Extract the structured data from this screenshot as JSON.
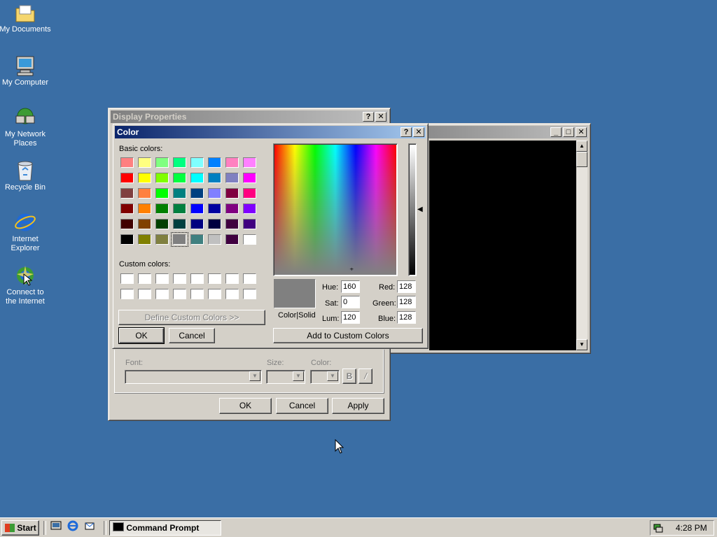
{
  "desktop": {
    "background": "#3a6ea5",
    "icons": [
      {
        "label_lines": [
          "My Documents"
        ],
        "icon": "folder-icon"
      },
      {
        "label_lines": [
          "My Computer"
        ],
        "icon": "computer-icon"
      },
      {
        "label_lines": [
          "My Network",
          "Places"
        ],
        "icon": "network-icon"
      },
      {
        "label_lines": [
          "Recycle Bin"
        ],
        "icon": "recycle-bin-icon"
      },
      {
        "label_lines": [
          "Internet",
          "Explorer"
        ],
        "icon": "ie-icon"
      },
      {
        "label_lines": [
          "Connect to",
          "the Internet"
        ],
        "icon": "connect-icon"
      }
    ]
  },
  "display_properties": {
    "title": "Display Properties",
    "font_label": "Font:",
    "size_label": "Size:",
    "color_label": "Color:",
    "bold_label": "B",
    "italic_label": "/",
    "ok_label": "OK",
    "cancel_label": "Cancel",
    "apply_label": "Apply"
  },
  "color_dialog": {
    "title": "Color",
    "basic_colors_label": "Basic colors:",
    "custom_colors_label": "Custom colors:",
    "define_custom_label": "Define Custom Colors >>",
    "ok_label": "OK",
    "cancel_label": "Cancel",
    "add_custom_label": "Add to Custom Colors",
    "color_solid_label": "Color|Solid",
    "selected_color": "#808080",
    "hue_label": "Hue:",
    "hue": "160",
    "sat_label": "Sat:",
    "sat": "0",
    "lum_label": "Lum:",
    "lum": "120",
    "red_label": "Red:",
    "red": "128",
    "green_label": "Green:",
    "green": "128",
    "blue_label": "Blue:",
    "blue": "128",
    "basic_colors": [
      [
        "#ff8080",
        "#ffff80",
        "#80ff80",
        "#00ff80",
        "#80ffff",
        "#0080ff",
        "#ff80c0",
        "#ff80ff"
      ],
      [
        "#ff0000",
        "#ffff00",
        "#80ff00",
        "#00ff40",
        "#00ffff",
        "#0080c0",
        "#8080c0",
        "#ff00ff"
      ],
      [
        "#804040",
        "#ff8040",
        "#00ff00",
        "#008080",
        "#004080",
        "#8080ff",
        "#800040",
        "#ff0080"
      ],
      [
        "#800000",
        "#ff8000",
        "#008000",
        "#008040",
        "#0000ff",
        "#0000a0",
        "#800080",
        "#8000ff"
      ],
      [
        "#400000",
        "#804000",
        "#004000",
        "#004040",
        "#000080",
        "#000040",
        "#400040",
        "#400080"
      ],
      [
        "#000000",
        "#808000",
        "#808040",
        "#808080",
        "#408080",
        "#c0c0c0",
        "#400040",
        "#ffffff"
      ]
    ],
    "selected_swatch": "#808080"
  },
  "console": {
    "title": "Command Prompt"
  },
  "taskbar": {
    "start_label": "Start",
    "task_label": "Command Prompt",
    "clock": "4:28 PM"
  }
}
